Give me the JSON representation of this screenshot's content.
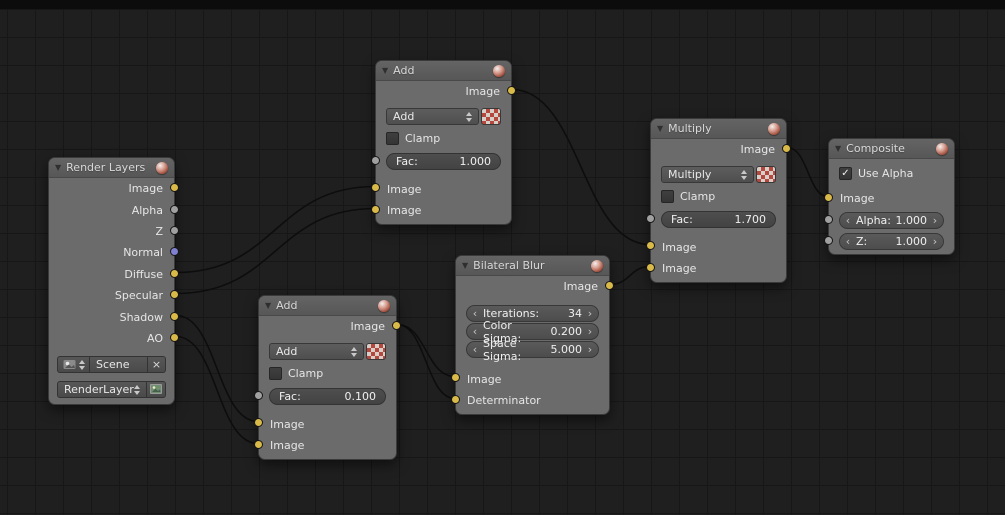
{
  "editor": {
    "background": "#1f1f1f",
    "grid_line": "#171717",
    "top_bar": "#0c0c0c",
    "wire_color": "#0d0d0d"
  },
  "colors": {
    "node_body": "#6b6b6b",
    "node_header": "#5e5e5e",
    "socket_image": "#d9b948",
    "socket_value": "#a0a0a0",
    "socket_vector": "#8080d0"
  },
  "icons": {
    "collapse": "▼",
    "chevron_left": "‹",
    "chevron_right": "›",
    "close": "×",
    "check": "✓"
  },
  "nodes": {
    "render_layers": {
      "title": "Render Layers",
      "outputs": [
        "Image",
        "Alpha",
        "Z",
        "Normal",
        "Diffuse",
        "Specular",
        "Shadow",
        "AO"
      ],
      "scene_value": "Scene",
      "layer_value": "RenderLayer"
    },
    "add_top": {
      "title": "Add",
      "output_label": "Image",
      "mode": "Add",
      "clamp_label": "Clamp",
      "fac_label": "Fac:",
      "fac_value": "1.000",
      "inputs": [
        "Image",
        "Image"
      ]
    },
    "add_bottom": {
      "title": "Add",
      "output_label": "Image",
      "mode": "Add",
      "clamp_label": "Clamp",
      "fac_label": "Fac:",
      "fac_value": "0.100",
      "inputs": [
        "Image",
        "Image"
      ]
    },
    "bilateral": {
      "title": "Bilateral Blur",
      "output_label": "Image",
      "fields": [
        {
          "label": "Iterations:",
          "value": "34"
        },
        {
          "label": "Color Sigma:",
          "value": "0.200"
        },
        {
          "label": "Space Sigma:",
          "value": "5.000"
        }
      ],
      "inputs": [
        "Image",
        "Determinator"
      ]
    },
    "multiply": {
      "title": "Multiply",
      "output_label": "Image",
      "mode": "Multiply",
      "clamp_label": "Clamp",
      "fac_label": "Fac:",
      "fac_value": "1.700",
      "inputs": [
        "Image",
        "Image"
      ]
    },
    "composite": {
      "title": "Composite",
      "use_alpha_label": "Use Alpha",
      "image_label": "Image",
      "alpha": {
        "label": "Alpha:",
        "value": "1.000"
      },
      "z": {
        "label": "Z:",
        "value": "1.000"
      }
    }
  },
  "links": [
    {
      "from": "Render Layers.Diffuse",
      "to": "Add.Image 1"
    },
    {
      "from": "Render Layers.Specular",
      "to": "Add.Image 2"
    },
    {
      "from": "Render Layers.Shadow",
      "to": "Add (lower).Image 1"
    },
    {
      "from": "Render Layers.AO",
      "to": "Add (lower).Image 2"
    },
    {
      "from": "Add.Image",
      "to": "Multiply.Image 1"
    },
    {
      "from": "Add (lower).Image",
      "to": "Bilateral Blur.Image"
    },
    {
      "from": "Add (lower).Image",
      "to": "Bilateral Blur.Determinator"
    },
    {
      "from": "Bilateral Blur.Image",
      "to": "Multiply.Image 2"
    },
    {
      "from": "Multiply.Image",
      "to": "Composite.Image"
    }
  ]
}
